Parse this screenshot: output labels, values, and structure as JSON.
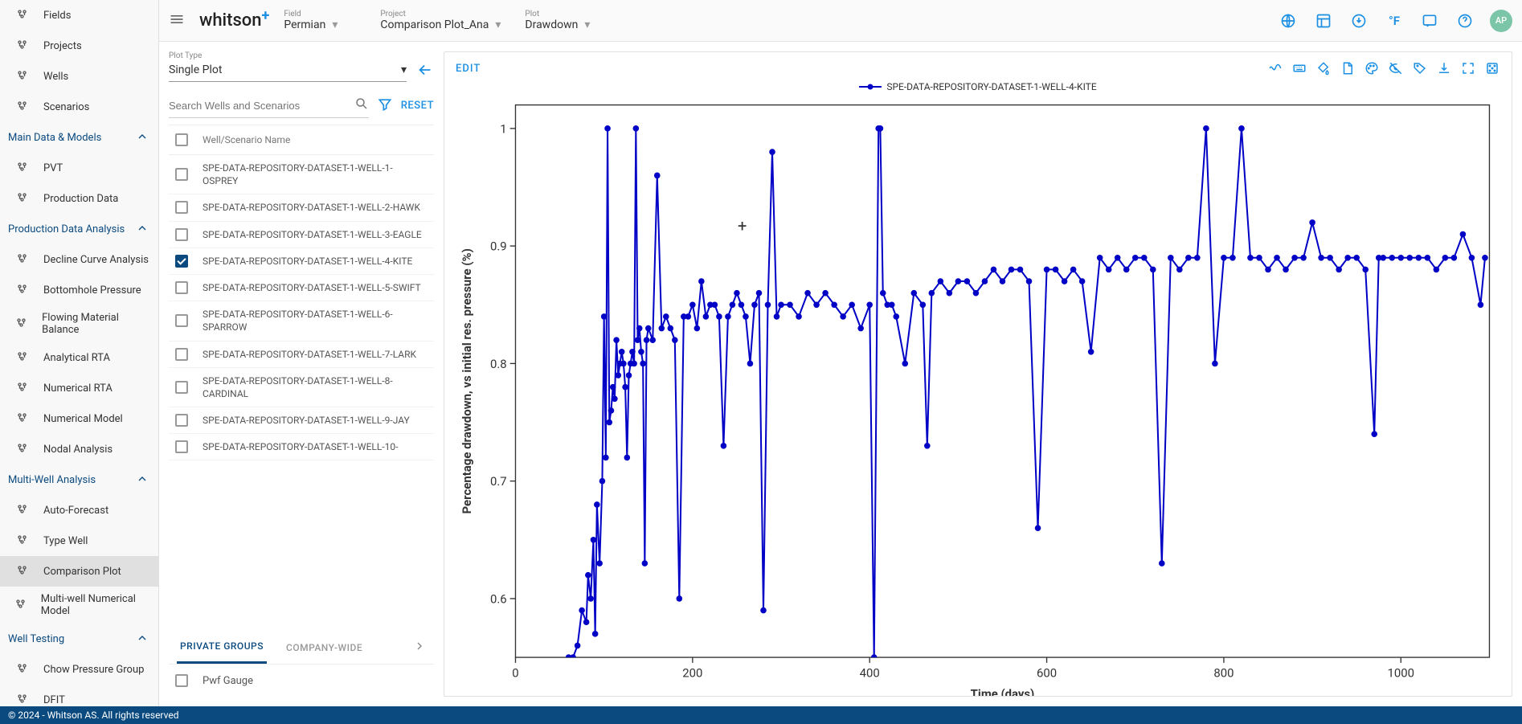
{
  "sidebar": {
    "top": [
      {
        "label": "Fields",
        "icon": "dots"
      },
      {
        "label": "Projects",
        "icon": "dots2"
      },
      {
        "label": "Wells",
        "icon": "lines"
      },
      {
        "label": "Scenarios",
        "icon": "tree"
      }
    ],
    "groups": [
      {
        "title": "Main Data & Models",
        "items": [
          {
            "label": "PVT",
            "icon": "flask"
          },
          {
            "label": "Production Data",
            "icon": "trend"
          }
        ]
      },
      {
        "title": "Production Data Analysis",
        "items": [
          {
            "label": "Decline Curve Analysis",
            "icon": "scissors"
          },
          {
            "label": "Bottomhole Pressure",
            "icon": "gauge"
          },
          {
            "label": "Flowing Material Balance",
            "icon": "chart"
          },
          {
            "label": "Analytical RTA",
            "icon": "trend"
          },
          {
            "label": "Numerical RTA",
            "icon": "stairs"
          },
          {
            "label": "Numerical Model",
            "icon": "grid"
          },
          {
            "label": "Nodal Analysis",
            "icon": "curve"
          }
        ]
      },
      {
        "title": "Multi-Well Analysis",
        "items": [
          {
            "label": "Auto-Forecast",
            "icon": "tiles"
          },
          {
            "label": "Type Well",
            "icon": "bars"
          },
          {
            "label": "Comparison Plot",
            "icon": "target",
            "active": true
          },
          {
            "label": "Multi-well Numerical Model",
            "icon": "grid"
          }
        ]
      },
      {
        "title": "Well Testing",
        "items": [
          {
            "label": "Chow Pressure Group",
            "icon": "dots3"
          },
          {
            "label": "DFIT",
            "icon": "angle"
          }
        ]
      }
    ]
  },
  "topbar": {
    "logo": "whitson",
    "crumbs": [
      {
        "label": "Field",
        "value": "Permian"
      },
      {
        "label": "Project",
        "value": "Comparison Plot_Ana"
      },
      {
        "label": "Plot",
        "value": "Drawdown"
      }
    ],
    "tempUnit": "°F",
    "avatar": "AP"
  },
  "wellPanel": {
    "plotTypeLabel": "Plot Type",
    "plotTypeValue": "Single Plot",
    "searchPlaceholder": "Search Wells and Scenarios",
    "resetLabel": "RESET",
    "headerLabel": "Well/Scenario Name",
    "wells": [
      {
        "name": "SPE-DATA-REPOSITORY-DATASET-1-WELL-1-OSPREY",
        "checked": false
      },
      {
        "name": "SPE-DATA-REPOSITORY-DATASET-1-WELL-2-HAWK",
        "checked": false
      },
      {
        "name": "SPE-DATA-REPOSITORY-DATASET-1-WELL-3-EAGLE",
        "checked": false
      },
      {
        "name": "SPE-DATA-REPOSITORY-DATASET-1-WELL-4-KITE",
        "checked": true
      },
      {
        "name": "SPE-DATA-REPOSITORY-DATASET-1-WELL-5-SWIFT",
        "checked": false
      },
      {
        "name": "SPE-DATA-REPOSITORY-DATASET-1-WELL-6-SPARROW",
        "checked": false
      },
      {
        "name": "SPE-DATA-REPOSITORY-DATASET-1-WELL-7-LARK",
        "checked": false
      },
      {
        "name": "SPE-DATA-REPOSITORY-DATASET-1-WELL-8-CARDINAL",
        "checked": false
      },
      {
        "name": "SPE-DATA-REPOSITORY-DATASET-1-WELL-9-JAY",
        "checked": false
      },
      {
        "name": "SPE-DATA-REPOSITORY-DATASET-1-WELL-10-",
        "checked": false
      }
    ],
    "tabs": [
      "PRIVATE GROUPS",
      "COMPANY-WIDE"
    ],
    "activeTab": 0,
    "groupItem": "Pwf Gauge"
  },
  "chart": {
    "editLabel": "EDIT",
    "legend": "SPE-DATA-REPOSITORY-DATASET-1-WELL-4-KITE",
    "xlabel": "Time (days)",
    "ylabel": "Percentage drawdown, vs initial res. pressure (%)",
    "xticks": [
      0,
      200,
      400,
      600,
      800,
      1000
    ],
    "yticks": [
      0.6,
      0.7,
      0.8,
      0.9,
      1
    ]
  },
  "chart_data": {
    "type": "scatter",
    "title": "",
    "xlabel": "Time (days)",
    "ylabel": "Percentage drawdown, vs initial res. pressure (%)",
    "xlim": [
      0,
      1100
    ],
    "ylim": [
      0.55,
      1.02
    ],
    "series": [
      {
        "name": "SPE-DATA-REPOSITORY-DATASET-1-WELL-4-KITE",
        "color": "#0202c7",
        "note": "Dense time-series, ~550 points. Values below are representative sampled points read from the plot.",
        "x": [
          60,
          65,
          70,
          75,
          80,
          82,
          85,
          88,
          90,
          92,
          95,
          98,
          100,
          102,
          104,
          106,
          108,
          110,
          112,
          114,
          116,
          118,
          120,
          122,
          124,
          126,
          128,
          130,
          132,
          134,
          136,
          138,
          140,
          142,
          144,
          146,
          148,
          150,
          155,
          160,
          165,
          170,
          175,
          180,
          185,
          190,
          195,
          200,
          205,
          210,
          215,
          220,
          225,
          230,
          235,
          240,
          245,
          250,
          255,
          260,
          265,
          270,
          275,
          280,
          285,
          290,
          295,
          300,
          310,
          320,
          330,
          340,
          350,
          360,
          370,
          380,
          390,
          400,
          405,
          410,
          412,
          415,
          420,
          425,
          430,
          440,
          450,
          460,
          465,
          470,
          480,
          490,
          500,
          510,
          520,
          530,
          540,
          550,
          560,
          570,
          580,
          590,
          600,
          610,
          620,
          630,
          640,
          650,
          660,
          670,
          680,
          690,
          700,
          710,
          720,
          730,
          740,
          750,
          760,
          770,
          780,
          790,
          800,
          810,
          820,
          830,
          840,
          850,
          860,
          870,
          880,
          890,
          900,
          910,
          920,
          930,
          940,
          950,
          960,
          970,
          975,
          980,
          990,
          1000,
          1010,
          1020,
          1030,
          1040,
          1050,
          1060,
          1070,
          1080,
          1090,
          1095
        ],
        "y": [
          0.55,
          0.55,
          0.56,
          0.59,
          0.58,
          0.62,
          0.6,
          0.65,
          0.57,
          0.68,
          0.63,
          0.7,
          0.84,
          0.72,
          1.0,
          0.75,
          0.76,
          0.78,
          0.77,
          0.82,
          0.79,
          0.8,
          0.81,
          0.8,
          0.78,
          0.72,
          0.79,
          0.8,
          0.81,
          0.8,
          1.0,
          0.82,
          0.83,
          0.81,
          0.8,
          0.63,
          0.82,
          0.83,
          0.82,
          0.96,
          0.83,
          0.84,
          0.83,
          0.82,
          0.6,
          0.84,
          0.84,
          0.85,
          0.83,
          0.87,
          0.84,
          0.85,
          0.85,
          0.84,
          0.73,
          0.84,
          0.85,
          0.86,
          0.85,
          0.84,
          0.8,
          0.85,
          0.86,
          0.59,
          0.85,
          0.98,
          0.84,
          0.85,
          0.85,
          0.84,
          0.86,
          0.85,
          0.86,
          0.85,
          0.84,
          0.85,
          0.83,
          0.85,
          0.55,
          1.0,
          1.0,
          0.86,
          0.85,
          0.85,
          0.84,
          0.8,
          0.86,
          0.85,
          0.73,
          0.86,
          0.87,
          0.86,
          0.87,
          0.87,
          0.86,
          0.87,
          0.88,
          0.87,
          0.88,
          0.88,
          0.87,
          0.66,
          0.88,
          0.88,
          0.87,
          0.88,
          0.87,
          0.81,
          0.89,
          0.88,
          0.89,
          0.88,
          0.89,
          0.89,
          0.88,
          0.63,
          0.89,
          0.88,
          0.89,
          0.89,
          1.0,
          0.8,
          0.89,
          0.89,
          1.0,
          0.89,
          0.89,
          0.88,
          0.89,
          0.88,
          0.89,
          0.89,
          0.92,
          0.89,
          0.89,
          0.88,
          0.89,
          0.89,
          0.88,
          0.74,
          0.89,
          0.89,
          0.89,
          0.89,
          0.89,
          0.89,
          0.89,
          0.88,
          0.89,
          0.89,
          0.91,
          0.89,
          0.85,
          0.89
        ]
      }
    ]
  },
  "footer": "© 2024 - Whitson AS. All rights reserved"
}
